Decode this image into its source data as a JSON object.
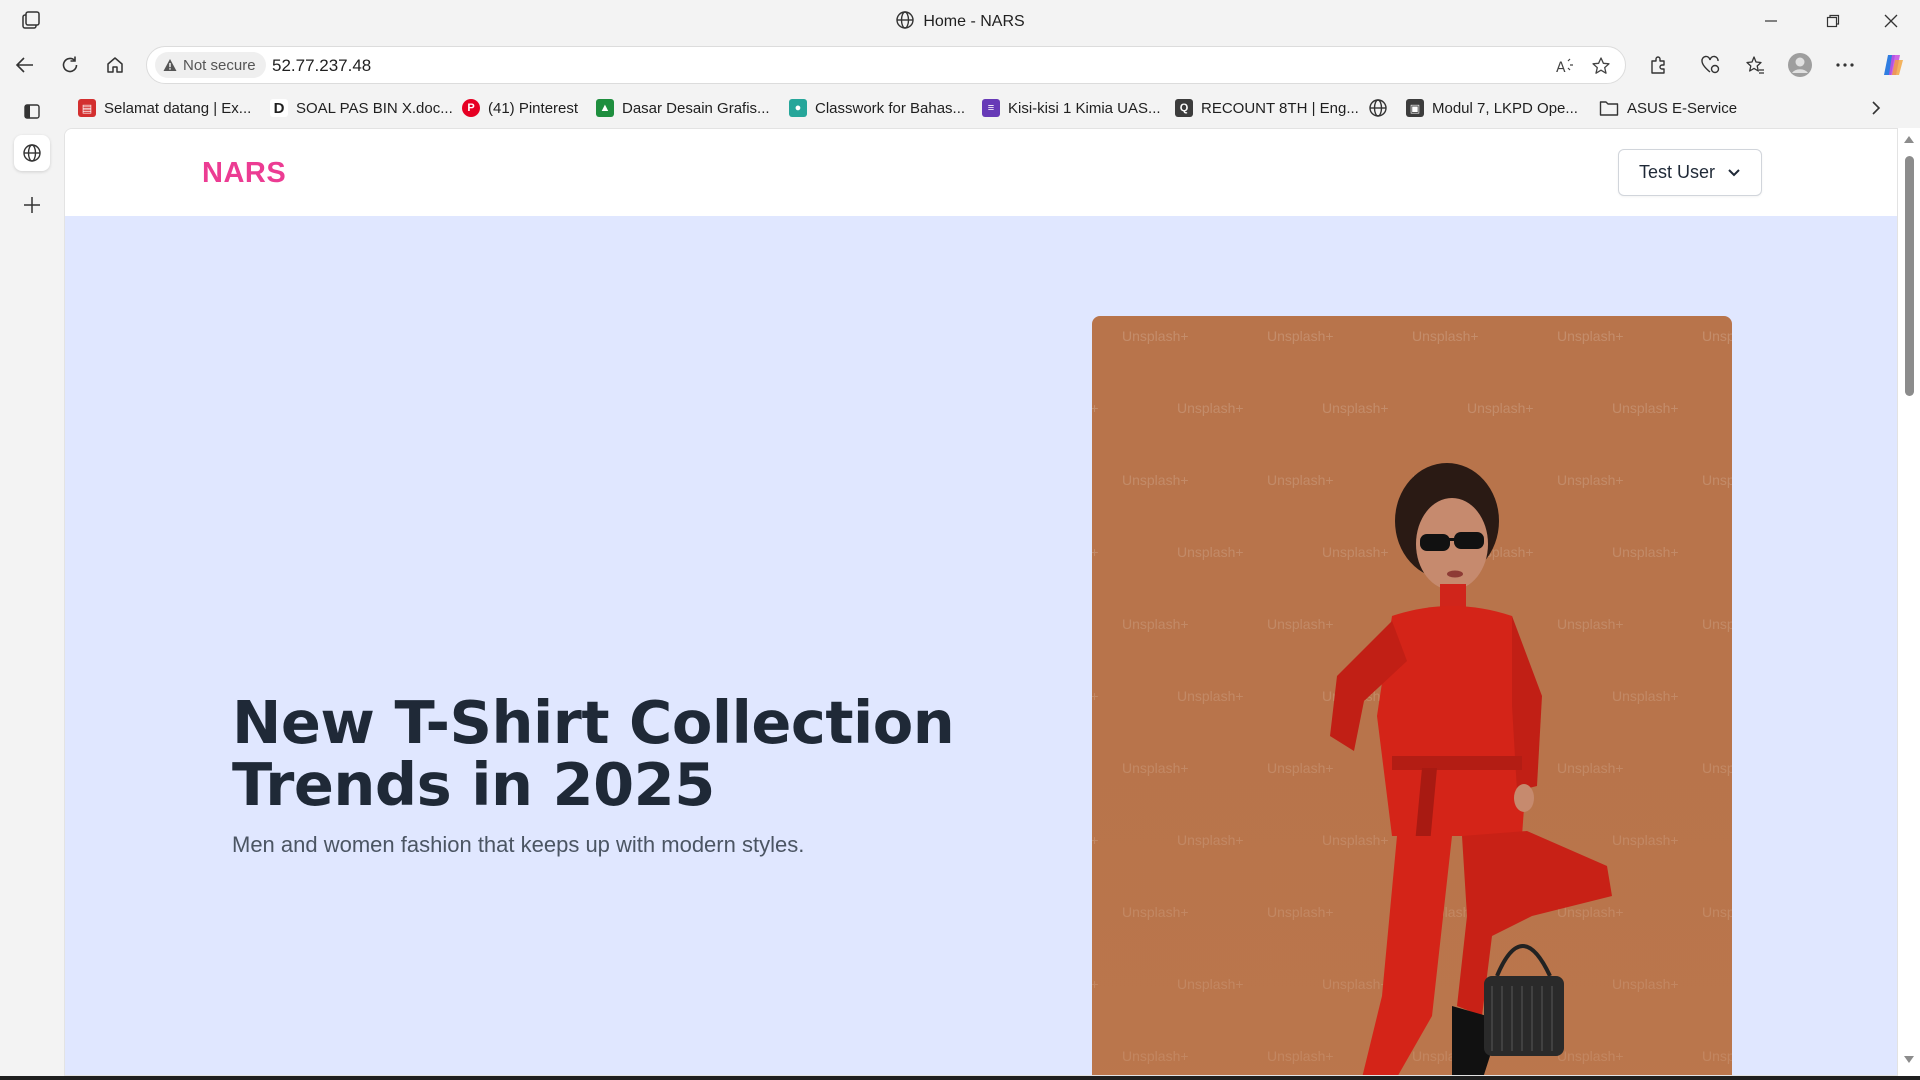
{
  "window": {
    "title": "Home - NARS"
  },
  "toolbar": {
    "security_label": "Not secure",
    "url": "52.77.237.48"
  },
  "bookmarks": [
    {
      "label": "Selamat datang | Ex...",
      "color": "#d32f2f",
      "glyph": "▤"
    },
    {
      "label": "SOAL PAS BIN X.doc...",
      "color": "#1f1f1f",
      "glyph": "D"
    },
    {
      "label": "(41) Pinterest",
      "color": "#e60023",
      "glyph": "P"
    },
    {
      "label": "Dasar Desain Grafis...",
      "color": "#1e8e3e",
      "glyph": "▲"
    },
    {
      "label": "Classwork for Bahas...",
      "color": "#26a69a",
      "glyph": "●"
    },
    {
      "label": "Kisi-kisi 1 Kimia UAS...",
      "color": "#673ab7",
      "glyph": "≡"
    },
    {
      "label": "RECOUNT 8TH | Eng...",
      "color": "#3c3c3c",
      "glyph": "Q"
    },
    {
      "label": "",
      "color": "#555555",
      "glyph": "◎"
    },
    {
      "label": "Modul 7, LKPD Ope...",
      "color": "#3c3c3c",
      "glyph": "▣"
    },
    {
      "label": "ASUS E-Service",
      "color": "#555555",
      "glyph": "▭"
    }
  ],
  "site": {
    "logo": "NARS",
    "user_menu_label": "Test User",
    "hero": {
      "title_line1": "New T-Shirt Collection",
      "title_line2": "Trends in 2025",
      "subtitle": "Men and women fashion that keeps up with modern styles.",
      "image_watermark": "Unsplash+"
    }
  },
  "colors": {
    "brand": "#ec3c93",
    "hero_bg": "#e0e7ff",
    "photo_bg": "#b8744b",
    "outfit": "#d42418"
  }
}
